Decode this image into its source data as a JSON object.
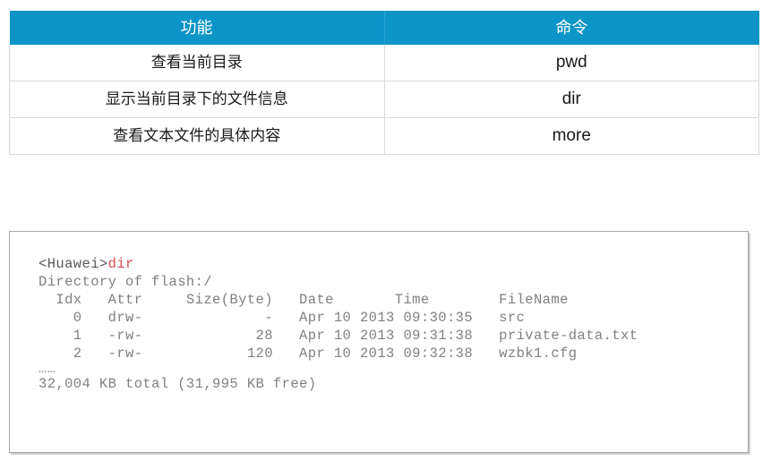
{
  "command_table": {
    "headers": {
      "function": "功能",
      "command": "命令"
    },
    "header_bg": "#0d95c8",
    "header_text_color": "#ffffff",
    "rows": [
      {
        "function": "查看当前目录",
        "command": "pwd"
      },
      {
        "function": "显示当前目录下的文件信息",
        "command": "dir"
      },
      {
        "function": "查看文本文件的具体内容",
        "command": "more"
      }
    ]
  },
  "cli": {
    "prompt": "<Huawei>",
    "typed_command": "dir",
    "prompt_color": "#595959",
    "command_color": "#d94a52",
    "text_color": "#808080",
    "lines": [
      "Directory of flash:/",
      "  Idx   Attr     Size(Byte)   Date       Time        FileName",
      "    0   drw-              -   Apr 10 2013 09:30:35   src",
      "    1   -rw-             28   Apr 10 2013 09:31:38   private-data.txt",
      "    2   -rw-            120   Apr 10 2013 09:32:38   wzbk1.cfg"
    ],
    "ellipsis": "……",
    "summary": "32,004 KB total (31,995 KB free)"
  }
}
